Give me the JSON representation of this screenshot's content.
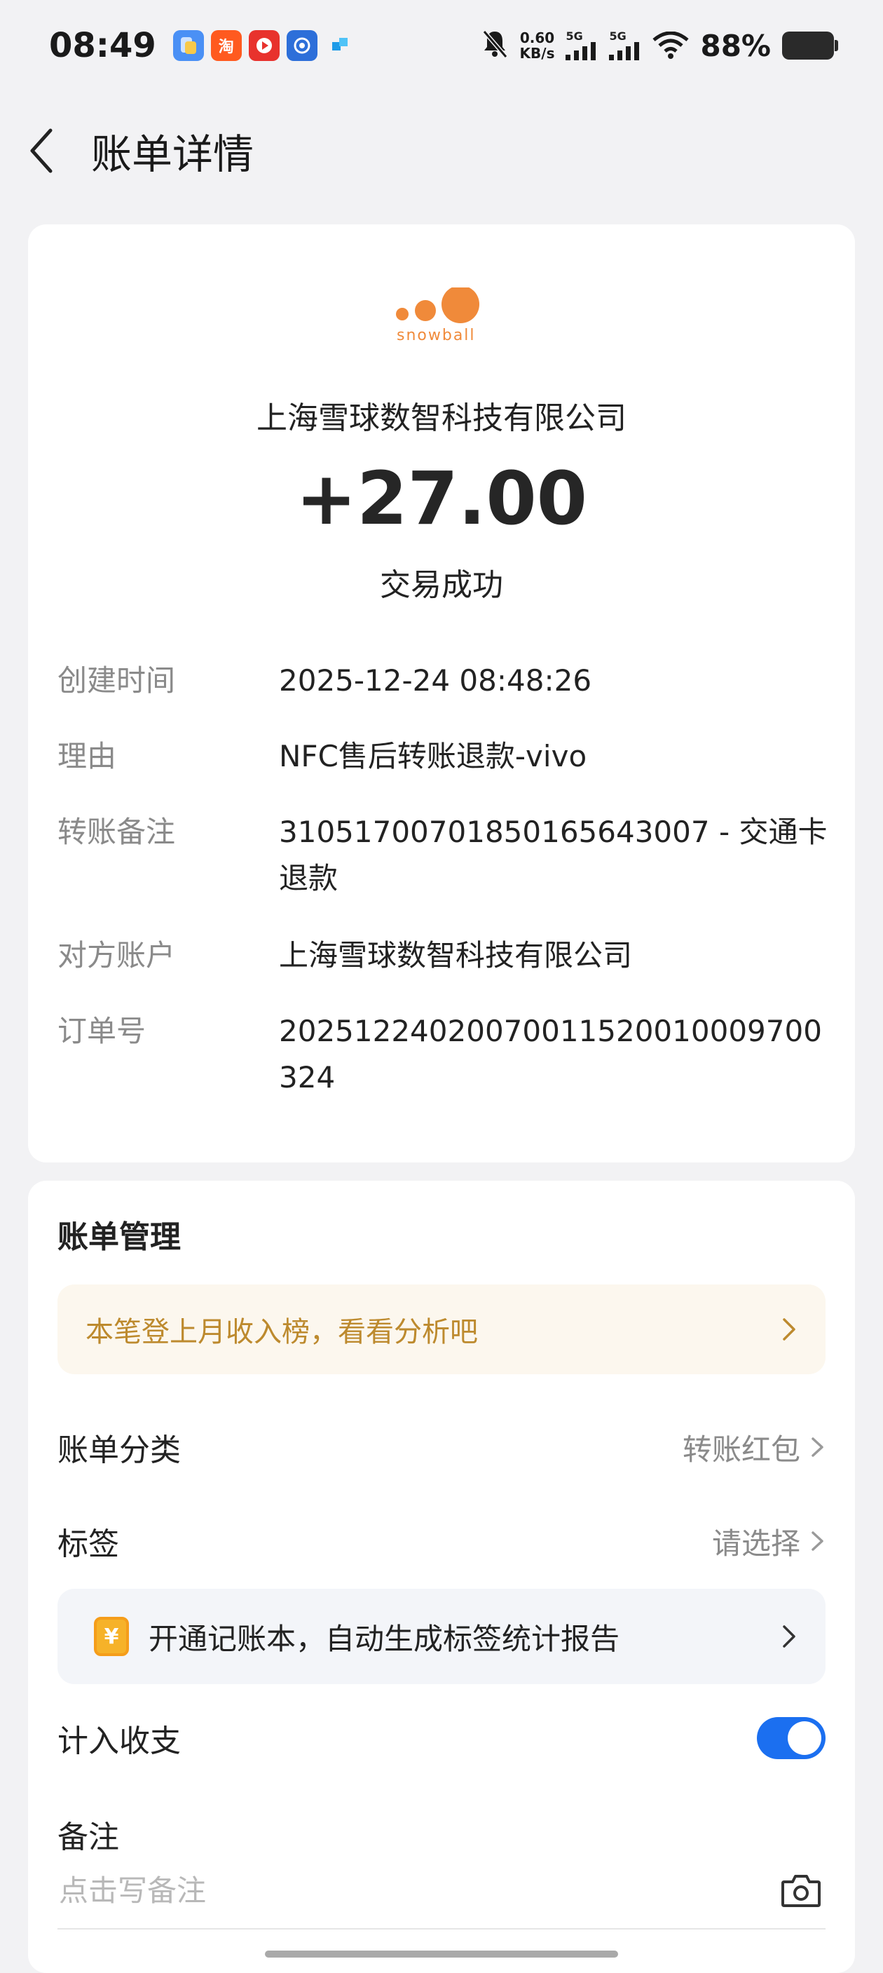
{
  "status_bar": {
    "time": "08:49",
    "net_speed_value": "0.60",
    "net_speed_unit": "KB/s",
    "sim1_label": "5G",
    "sim2_label": "5G",
    "battery_percent": "88%",
    "app_icons": [
      "files-app-icon",
      "taobao-app-icon",
      "video-app-icon",
      "shield-app-icon",
      "blocks-app-icon"
    ],
    "taobao_icon_text": "淘"
  },
  "header": {
    "title": "账单详情"
  },
  "transaction": {
    "company": "上海雪球数智科技有限公司",
    "logo_text": "snowball",
    "amount": "+27.00",
    "status": "交易成功",
    "details": [
      {
        "label": "创建时间",
        "value": "2025-12-24 08:48:26"
      },
      {
        "label": "理由",
        "value": "NFC售后转账退款-vivo"
      },
      {
        "label": "转账备注",
        "value": "310517007018501656430​07 - 交通卡退款"
      },
      {
        "label": "对方账户",
        "value": "上海雪球数智科技有限公司"
      },
      {
        "label": "订单号",
        "value": "20251224020070011520010009700324"
      }
    ]
  },
  "management": {
    "title": "账单管理",
    "hint": "本笔登上月收入榜，看看分析吧",
    "category_label": "账单分类",
    "category_value": "转账红包",
    "tag_label": "标签",
    "tag_value": "请选择",
    "promo_text": "开通记账本，自动生成标签统计报告",
    "promo_icon_text": "¥",
    "include_label": "计入收支",
    "include_enabled": true,
    "note_label": "备注",
    "note_placeholder": "点击写备注",
    "note_value": ""
  },
  "colors": {
    "accent": "#1b6ff0",
    "hint_text": "#bd8a2e",
    "brand_orange": "#f08a3a"
  }
}
